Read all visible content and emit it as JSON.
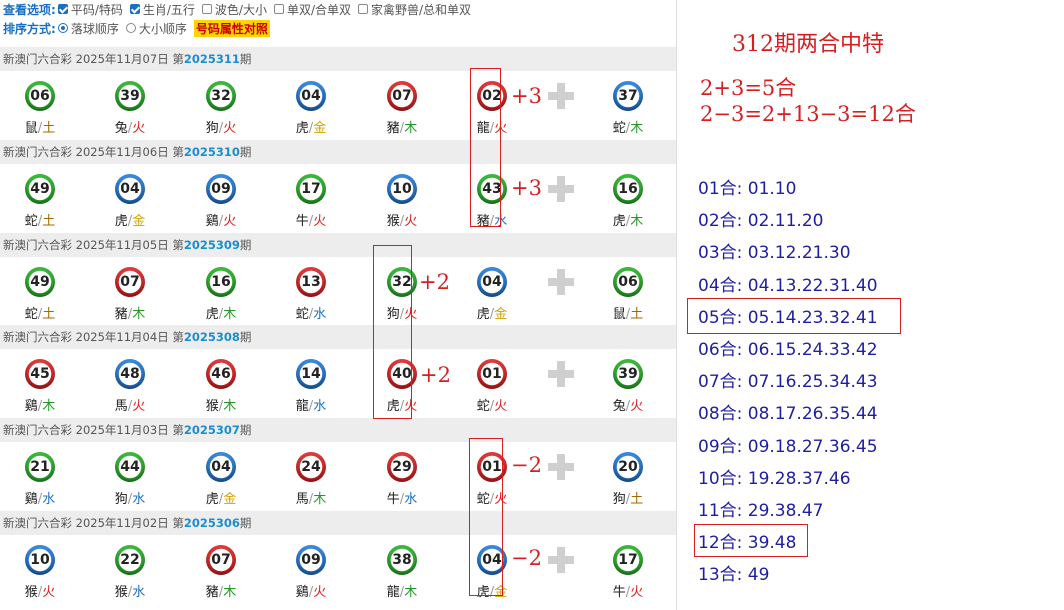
{
  "options": {
    "view_label": "查看选项:",
    "view_items": [
      {
        "label": "平码/特码",
        "checked": true
      },
      {
        "label": "生肖/五行",
        "checked": true
      },
      {
        "label": "波色/大小",
        "checked": false
      },
      {
        "label": "单双/合单双",
        "checked": false
      },
      {
        "label": "家禽野兽/总和单双",
        "checked": false
      }
    ],
    "sort_label": "排序方式:",
    "sort_items": [
      {
        "label": "落球顺序",
        "selected": true
      },
      {
        "label": "大小顺序",
        "selected": false
      }
    ],
    "highlight_button": "号码属性对照"
  },
  "draws": [
    {
      "prefix": "新澳门六合彩 2025年11月07日 第",
      "issue": "2025311",
      "suffix": "期",
      "balls": [
        {
          "num": "06",
          "color": "green",
          "zodiac": "鼠",
          "element": "土",
          "el": "earth"
        },
        {
          "num": "39",
          "color": "green",
          "zodiac": "兔",
          "element": "火",
          "el": "fire"
        },
        {
          "num": "32",
          "color": "green",
          "zodiac": "狗",
          "element": "火",
          "el": "fire"
        },
        {
          "num": "04",
          "color": "blue",
          "zodiac": "虎",
          "element": "金",
          "el": "gold"
        },
        {
          "num": "07",
          "color": "red",
          "zodiac": "豬",
          "element": "木",
          "el": "wood"
        },
        {
          "num": "02",
          "color": "red",
          "zodiac": "龍",
          "element": "火",
          "el": "fire"
        },
        {
          "num": "37",
          "color": "blue",
          "zodiac": "蛇",
          "element": "木",
          "el": "wood"
        }
      ],
      "annotation": "+3"
    },
    {
      "prefix": "新澳门六合彩 2025年11月06日 第",
      "issue": "2025310",
      "suffix": "期",
      "balls": [
        {
          "num": "49",
          "color": "green",
          "zodiac": "蛇",
          "element": "土",
          "el": "earth"
        },
        {
          "num": "04",
          "color": "blue",
          "zodiac": "虎",
          "element": "金",
          "el": "gold"
        },
        {
          "num": "09",
          "color": "blue",
          "zodiac": "鷄",
          "element": "火",
          "el": "fire"
        },
        {
          "num": "17",
          "color": "green",
          "zodiac": "牛",
          "element": "火",
          "el": "fire"
        },
        {
          "num": "10",
          "color": "blue",
          "zodiac": "猴",
          "element": "火",
          "el": "fire"
        },
        {
          "num": "43",
          "color": "green",
          "zodiac": "豬",
          "element": "水",
          "el": "water"
        },
        {
          "num": "16",
          "color": "green",
          "zodiac": "虎",
          "element": "木",
          "el": "wood"
        }
      ],
      "annotation": "+3"
    },
    {
      "prefix": "新澳门六合彩 2025年11月05日 第",
      "issue": "2025309",
      "suffix": "期",
      "balls": [
        {
          "num": "49",
          "color": "green",
          "zodiac": "蛇",
          "element": "土",
          "el": "earth"
        },
        {
          "num": "07",
          "color": "red",
          "zodiac": "豬",
          "element": "木",
          "el": "wood"
        },
        {
          "num": "16",
          "color": "green",
          "zodiac": "虎",
          "element": "木",
          "el": "wood"
        },
        {
          "num": "13",
          "color": "red",
          "zodiac": "蛇",
          "element": "水",
          "el": "water"
        },
        {
          "num": "32",
          "color": "green",
          "zodiac": "狗",
          "element": "火",
          "el": "fire"
        },
        {
          "num": "04",
          "color": "blue",
          "zodiac": "虎",
          "element": "金",
          "el": "gold"
        },
        {
          "num": "06",
          "color": "green",
          "zodiac": "鼠",
          "element": "土",
          "el": "earth"
        }
      ],
      "annotation": "+2"
    },
    {
      "prefix": "新澳门六合彩 2025年11月04日 第",
      "issue": "2025308",
      "suffix": "期",
      "balls": [
        {
          "num": "45",
          "color": "red",
          "zodiac": "鷄",
          "element": "木",
          "el": "wood"
        },
        {
          "num": "48",
          "color": "blue",
          "zodiac": "馬",
          "element": "火",
          "el": "fire"
        },
        {
          "num": "46",
          "color": "red",
          "zodiac": "猴",
          "element": "木",
          "el": "wood"
        },
        {
          "num": "14",
          "color": "blue",
          "zodiac": "龍",
          "element": "水",
          "el": "water"
        },
        {
          "num": "40",
          "color": "red",
          "zodiac": "虎",
          "element": "火",
          "el": "fire"
        },
        {
          "num": "01",
          "color": "red",
          "zodiac": "蛇",
          "element": "火",
          "el": "fire"
        },
        {
          "num": "39",
          "color": "green",
          "zodiac": "兔",
          "element": "火",
          "el": "fire"
        }
      ],
      "annotation": "+2"
    },
    {
      "prefix": "新澳门六合彩 2025年11月03日 第",
      "issue": "2025307",
      "suffix": "期",
      "balls": [
        {
          "num": "21",
          "color": "green",
          "zodiac": "鷄",
          "element": "水",
          "el": "water"
        },
        {
          "num": "44",
          "color": "green",
          "zodiac": "狗",
          "element": "水",
          "el": "water"
        },
        {
          "num": "04",
          "color": "blue",
          "zodiac": "虎",
          "element": "金",
          "el": "gold"
        },
        {
          "num": "24",
          "color": "red",
          "zodiac": "馬",
          "element": "木",
          "el": "wood"
        },
        {
          "num": "29",
          "color": "red",
          "zodiac": "牛",
          "element": "水",
          "el": "water"
        },
        {
          "num": "01",
          "color": "red",
          "zodiac": "蛇",
          "element": "火",
          "el": "fire"
        },
        {
          "num": "20",
          "color": "blue",
          "zodiac": "狗",
          "element": "土",
          "el": "earth"
        }
      ],
      "annotation": "−2"
    },
    {
      "prefix": "新澳门六合彩 2025年11月02日 第",
      "issue": "2025306",
      "suffix": "期",
      "balls": [
        {
          "num": "10",
          "color": "blue",
          "zodiac": "猴",
          "element": "火",
          "el": "fire"
        },
        {
          "num": "22",
          "color": "green",
          "zodiac": "猴",
          "element": "水",
          "el": "water"
        },
        {
          "num": "07",
          "color": "red",
          "zodiac": "豬",
          "element": "木",
          "el": "wood"
        },
        {
          "num": "09",
          "color": "blue",
          "zodiac": "鷄",
          "element": "火",
          "el": "fire"
        },
        {
          "num": "38",
          "color": "green",
          "zodiac": "龍",
          "element": "木",
          "el": "wood"
        },
        {
          "num": "04",
          "color": "blue",
          "zodiac": "虎",
          "element": "金",
          "el": "gold"
        },
        {
          "num": "17",
          "color": "green",
          "zodiac": "牛",
          "element": "火",
          "el": "fire"
        }
      ],
      "annotation": "−2"
    }
  ],
  "right": {
    "title": "312期两合中特",
    "formula1": "2+3=5合",
    "formula2": "2−3=2+13−3=12合",
    "he_list": [
      {
        "label": "01合:",
        "nums": "01.10"
      },
      {
        "label": "02合:",
        "nums": "02.11.20"
      },
      {
        "label": "03合:",
        "nums": "03.12.21.30"
      },
      {
        "label": "04合:",
        "nums": "04.13.22.31.40"
      },
      {
        "label": "05合:",
        "nums": "05.14.23.32.41"
      },
      {
        "label": "06合:",
        "nums": "06.15.24.33.42"
      },
      {
        "label": "07合:",
        "nums": "07.16.25.34.43"
      },
      {
        "label": "08合:",
        "nums": "08.17.26.35.44"
      },
      {
        "label": "09合:",
        "nums": "09.18.27.36.45"
      },
      {
        "label": "10合:",
        "nums": "19.28.37.46"
      },
      {
        "label": "11合:",
        "nums": "29.38.47"
      },
      {
        "label": "12合:",
        "nums": "39.48"
      },
      {
        "label": "13合:",
        "nums": "49"
      }
    ]
  }
}
